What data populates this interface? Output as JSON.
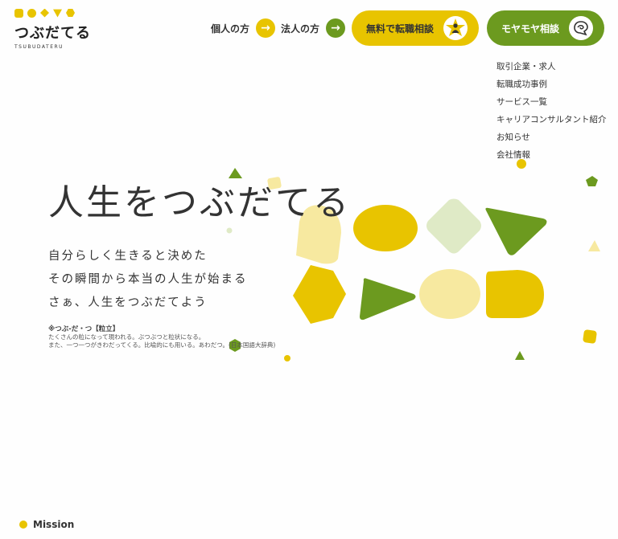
{
  "logo": {
    "text": "つぶだてる",
    "sub": "TSUBUDATERU"
  },
  "header": {
    "nav": [
      {
        "label": "個人の方",
        "arrow": "→",
        "color": "#e8c400"
      },
      {
        "label": "法人の方",
        "arrow": "→",
        "color": "#6c9a1f"
      }
    ],
    "cta_consult": {
      "label": "無料で転職相談",
      "icon": "star-person-icon",
      "color": "#e8c400"
    },
    "cta_moyamoya": {
      "label": "モヤモヤ相談",
      "icon": "speech-bubble-icon",
      "color": "#6c9a1f"
    }
  },
  "submenu": [
    "取引企業・求人",
    "転職成功事例",
    "サービス一覧",
    "キャリアコンサルタント紹介",
    "お知らせ",
    "会社情報"
  ],
  "hero": {
    "title": "人生をつぶだてる",
    "lead": [
      "自分らしく生きると決めた",
      "その瞬間から本当の人生が始まる",
      "さぁ、人生をつぶだてよう"
    ],
    "note": {
      "head": "※つぶ‐だ・つ【粒立】",
      "lines": [
        "たくさんの粒になって現われる。ぶつぶつと粒状になる。",
        "また、一つ一つがきわだってくる。比喩的にも用いる。あわだつ。(日本国語大辞典)"
      ]
    }
  },
  "section": {
    "label": "Mission"
  },
  "colors": {
    "yellow": "#e8c400",
    "green": "#6c9a1f",
    "light_yellow": "#f7e9a0",
    "light_green": "#dfeac6"
  }
}
